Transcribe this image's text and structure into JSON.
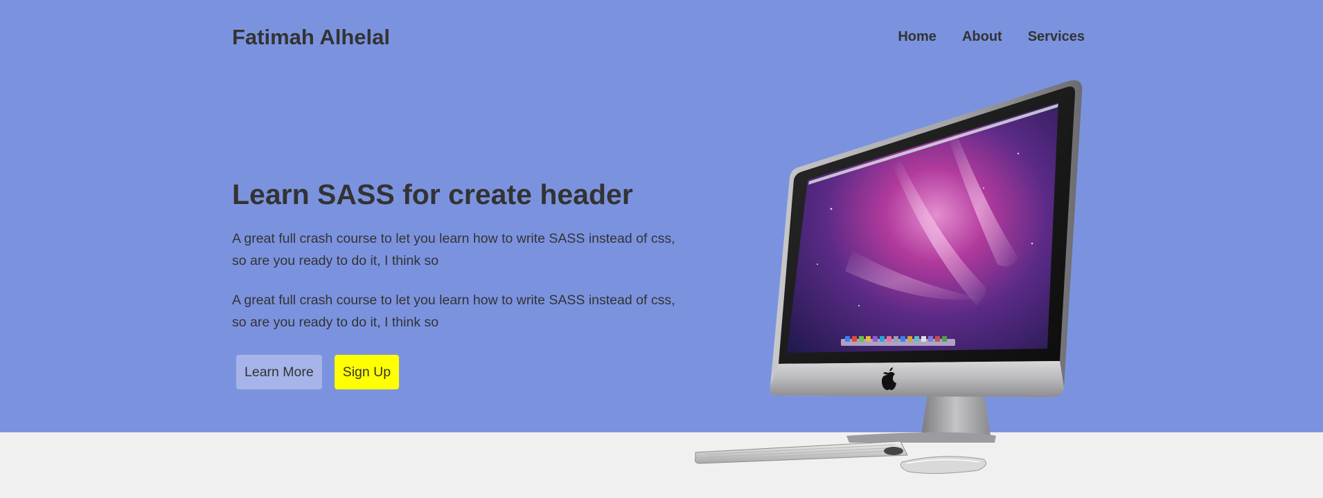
{
  "header": {
    "brand": "Fatimah Alhelal",
    "nav": [
      {
        "label": "Home"
      },
      {
        "label": "About"
      },
      {
        "label": "Services"
      }
    ]
  },
  "hero": {
    "title": "Learn SASS for create header",
    "paragraphs": [
      "A great full crash course to let you learn how to write SASS instead of css, so are you ready to do it, I think so",
      "A great full crash course to let you learn how to write SASS instead of css, so are you ready to do it, I think so"
    ],
    "buttons": {
      "learn_more": "Learn More",
      "sign_up": "Sign Up"
    },
    "image": {
      "icon": "imac-computer-image"
    }
  },
  "colors": {
    "hero_background": "#7b93df",
    "page_background": "#f0f0f0",
    "learn_more_bg": "#a6b4e9",
    "sign_up_bg": "#ffff00",
    "text": "#333333"
  }
}
